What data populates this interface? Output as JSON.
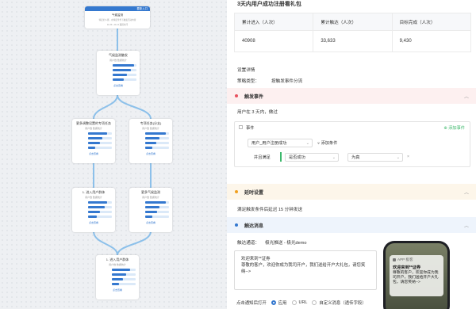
{
  "canvas": {
    "entry": {
      "header": "要新入口",
      "title": "气候监测",
      "text": [
        "特定的人群，在特定条件下触发活动内容",
        "11-09 ~11-12 跟踪时间"
      ]
    },
    "nodes": [
      {
        "title": "气候监测触发",
        "sub": "用户数 数据统计",
        "rows": [
          "",
          "",
          "",
          ""
        ],
        "fills": [
          0.9,
          0.75,
          0.6,
          0.45
        ],
        "btn": "点击查看"
      },
      {
        "title": "更多调整设置的专项任务",
        "sub": "用户数 数据统计",
        "rows": [
          "",
          "",
          "",
          ""
        ],
        "fills": [
          0.8,
          0.6,
          0.5,
          0.3
        ],
        "btn": "点击查看"
      },
      {
        "title": "专项任务(分支)",
        "sub": "用户数 数据统计",
        "rows": [
          "",
          "",
          "",
          ""
        ],
        "fills": [
          0.85,
          0.6,
          0.45,
          0.3
        ],
        "btn": "点击查看"
      },
      {
        "title": "1. 进入用户群体",
        "sub": "用户数 数据统计",
        "rows": [
          "",
          "",
          "",
          ""
        ],
        "fills": [
          0.8,
          0.7,
          0.5,
          0.35
        ],
        "btn": "点击查看"
      },
      {
        "title": "更多气候监测",
        "sub": "用户数 数据统计",
        "rows": [
          "",
          "",
          "",
          ""
        ],
        "fills": [
          0.85,
          0.6,
          0.5,
          0.3
        ],
        "btn": "点击查看"
      },
      {
        "title": "1. 进入用户群体",
        "sub": "用户数 数据统计",
        "rows": [
          "",
          "",
          "",
          ""
        ],
        "fills": [
          0.75,
          0.6,
          0.45,
          0.3
        ],
        "btn": "点击查看"
      }
    ]
  },
  "panel": {
    "title": "3天内用户成功注册看礼包",
    "stats": {
      "headers": [
        "累计进入（人次）",
        "累计触达（人次）",
        "目标完成（人次）"
      ],
      "values": [
        "40908",
        "33,633",
        "9,430"
      ]
    },
    "settings_label": "设置详情",
    "strategy_label": "策略类型：",
    "strategy_value": "按触发事件分流",
    "trigger_section": "触发事件",
    "trigger_desc": "用户在 3 天内，做过",
    "event_label": "事件",
    "add_event": "添加事件",
    "event_select": "用户_用户注册成功",
    "add_condition": "添加条件",
    "attr_label": "并且满足",
    "attr_select": "是否成功",
    "value_select": "为真",
    "delay_section": "延时设置",
    "delay_desc": "满足触发条件后延迟 15 分钟发送",
    "push_section": "触达消息",
    "channel_label": "触达通道：",
    "channel_value": "极光推送 - 极光demo",
    "msg_title": "欢迎来到**证券",
    "msg_body": "尊敬的客户，欢迎你成为我司开户，我们送给开户大礼包，请您笑纳-->",
    "click_label": "点击通知后打开",
    "options": [
      "应用",
      "URL",
      "自定义消息（透传字段）"
    ],
    "phone": {
      "app": "APP 极客",
      "title": "欢迎来到**证券",
      "body": "尊敬的客户，欢迎你成为我司开户，我们送给开户大礼包，请您笑纳-->"
    }
  },
  "colors": {
    "accent": "#3478cf",
    "trigger": "#e8525f",
    "delay": "#f0a020",
    "push": "#3478cf",
    "green": "#3db86c"
  }
}
